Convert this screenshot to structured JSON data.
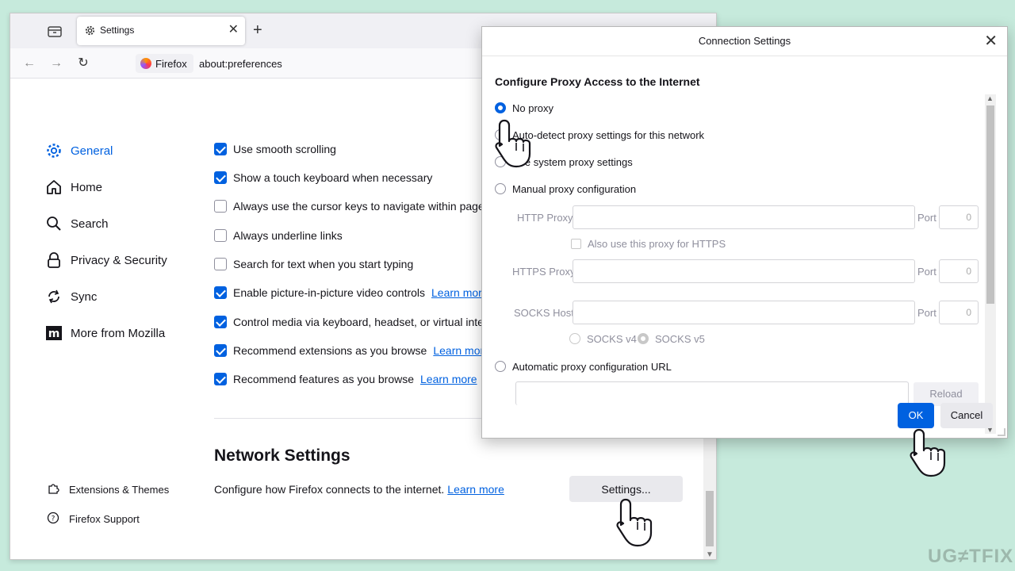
{
  "browser": {
    "tab_title": "Settings",
    "identity_label": "Firefox",
    "url": "about:preferences"
  },
  "sidebar": {
    "items": [
      {
        "label": "General",
        "icon": "gear-icon"
      },
      {
        "label": "Home",
        "icon": "home-icon"
      },
      {
        "label": "Search",
        "icon": "search-icon"
      },
      {
        "label": "Privacy & Security",
        "icon": "lock-icon"
      },
      {
        "label": "Sync",
        "icon": "sync-icon"
      },
      {
        "label": "More from Mozilla",
        "icon": "mozilla-icon"
      }
    ],
    "footer": [
      {
        "label": "Extensions & Themes",
        "icon": "puzzle-icon"
      },
      {
        "label": "Firefox Support",
        "icon": "help-icon"
      }
    ]
  },
  "prefs": [
    {
      "label": "Use smooth scrolling",
      "checked": true,
      "link": ""
    },
    {
      "label": "Show a touch keyboard when necessary",
      "checked": true,
      "link": ""
    },
    {
      "label": "Always use the cursor keys to navigate within pages",
      "checked": false,
      "link": ""
    },
    {
      "label": "Always underline links",
      "checked": false,
      "link": ""
    },
    {
      "label": "Search for text when you start typing",
      "checked": false,
      "link": ""
    },
    {
      "label": "Enable picture-in-picture video controls",
      "checked": true,
      "link": "Learn more"
    },
    {
      "label": "Control media via keyboard, headset, or virtual interface",
      "checked": true,
      "link": ""
    },
    {
      "label": "Recommend extensions as you browse",
      "checked": true,
      "link": "Learn more"
    },
    {
      "label": "Recommend features as you browse",
      "checked": true,
      "link": "Learn more"
    }
  ],
  "network": {
    "title": "Network Settings",
    "description": "Configure how Firefox connects to the internet.",
    "learn_more": "Learn more",
    "button": "Settings..."
  },
  "dialog": {
    "title": "Connection Settings",
    "heading": "Configure Proxy Access to the Internet",
    "options": [
      {
        "label": "No proxy",
        "selected": true
      },
      {
        "label": "Auto-detect proxy settings for this network",
        "selected": false
      },
      {
        "label": "Use system proxy settings",
        "selected": false
      },
      {
        "label": "Manual proxy configuration",
        "selected": false
      }
    ],
    "http_label": "HTTP Proxy",
    "port_label": "Port",
    "port_value": "0",
    "also_https": "Also use this proxy for HTTPS",
    "https_label": "HTTPS Proxy",
    "socks_label": "SOCKS Host",
    "socks_v4": "SOCKS v4",
    "socks_v5": "SOCKS v5",
    "auto_url_label": "Automatic proxy configuration URL",
    "reload": "Reload",
    "ok": "OK",
    "cancel": "Cancel"
  },
  "colors": {
    "accent": "#0061e0",
    "background": "#c6eadc"
  },
  "watermark": "UG≠TFIX"
}
